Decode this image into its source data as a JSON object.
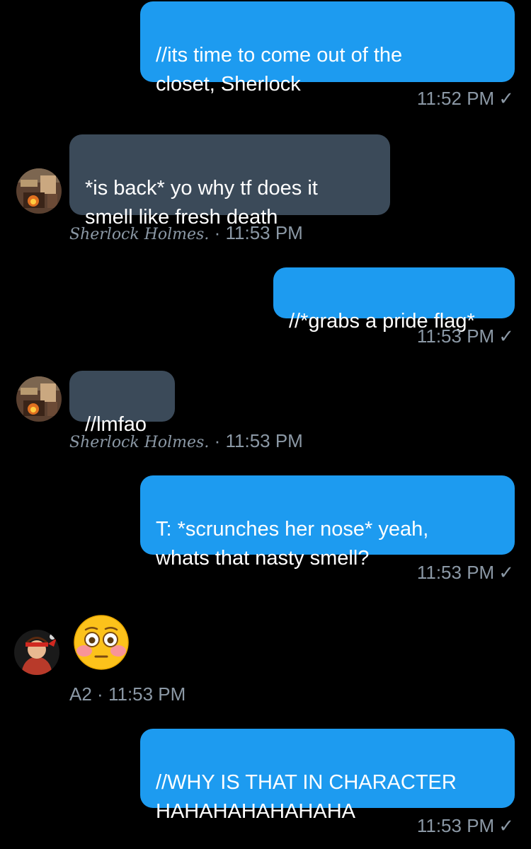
{
  "messages": [
    {
      "text": "//its time to come out of the\ncloset, Sherlock",
      "time": "11:52 PM",
      "check": "✓"
    },
    {
      "text": "*is back* yo why tf does it\nsmell like fresh death",
      "sender": "Sherlock Holmes.",
      "sep": "·",
      "time": "11:53 PM"
    },
    {
      "text": "//*grabs a pride flag*",
      "time": "11:53 PM",
      "check": "✓"
    },
    {
      "text": "//lmfao",
      "sender": "Sherlock Holmes.",
      "sep": "·",
      "time": "11:53 PM"
    },
    {
      "text": "T: *scrunches her nose* yeah,\nwhats that nasty smell?",
      "time": "11:53 PM",
      "check": "✓"
    },
    {
      "emoji": "flushed-face",
      "sender": "A2",
      "sep": "·",
      "time": "11:53 PM"
    },
    {
      "text": "//WHY IS THAT IN CHARACTER\nHAHAHAHAHAHAHA",
      "time": "11:53 PM",
      "check": "✓"
    }
  ],
  "colors": {
    "sent_bubble": "#1d9bf0",
    "received_bubble": "#3b4a59",
    "meta_text": "#8b98a5",
    "background": "#000000"
  }
}
